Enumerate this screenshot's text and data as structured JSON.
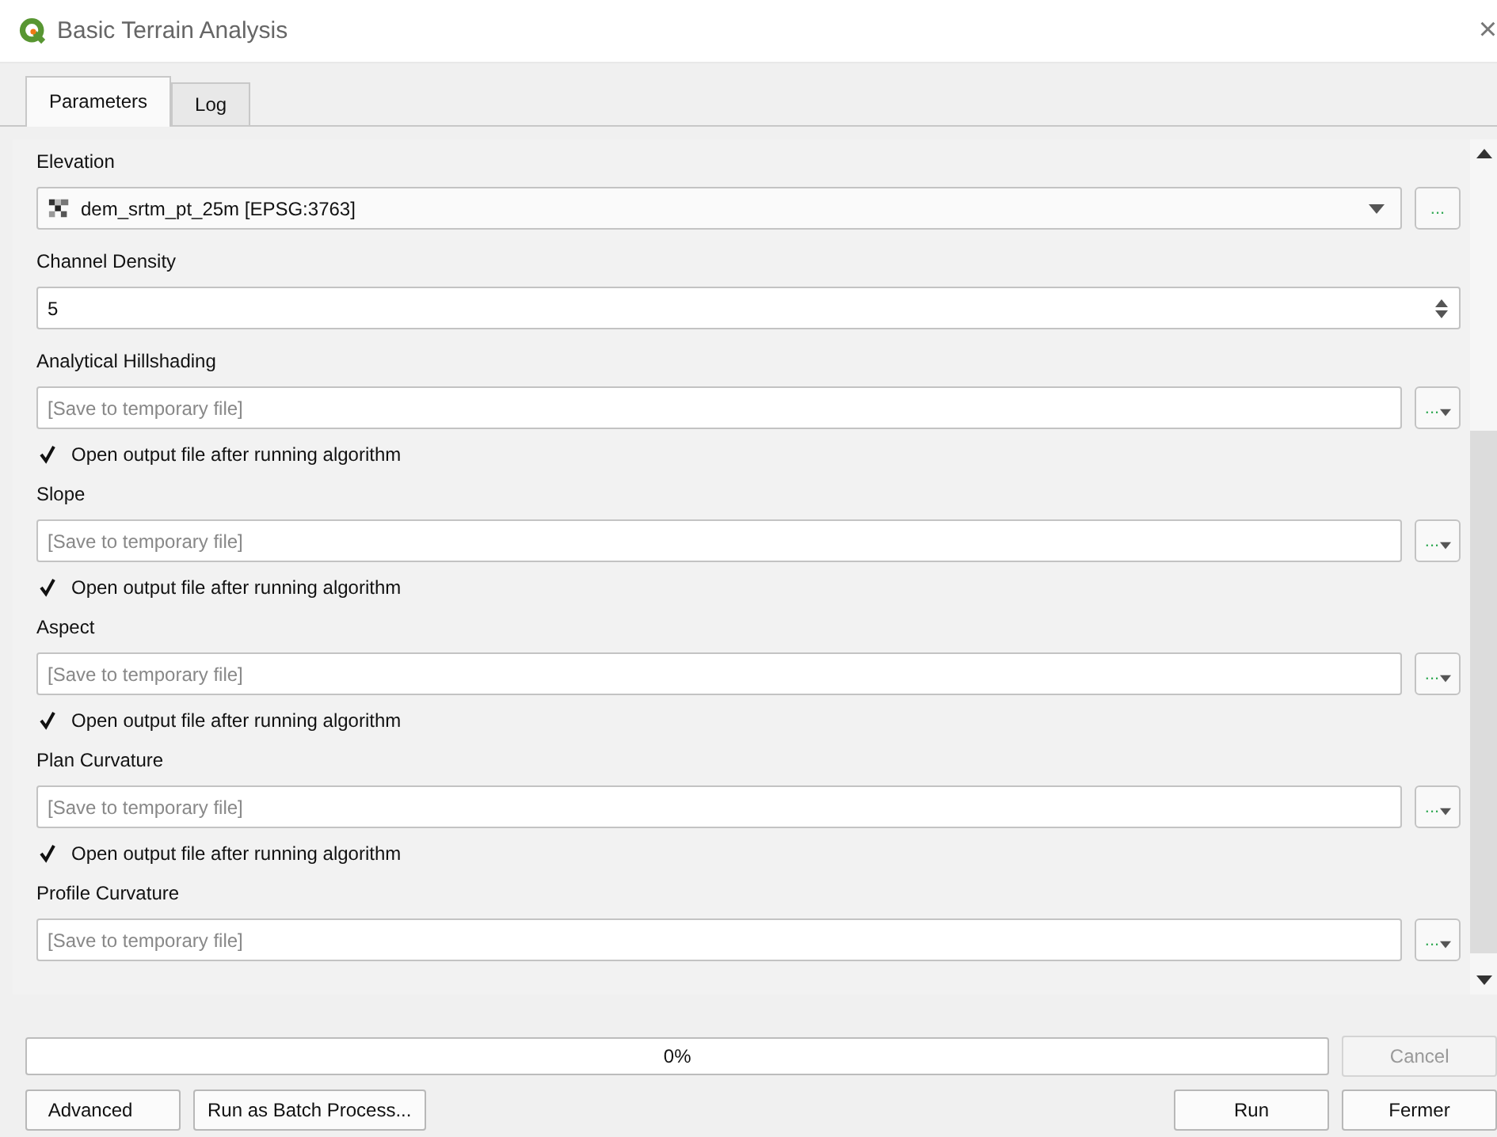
{
  "window": {
    "title": "Basic Terrain Analysis",
    "close": "×"
  },
  "tabs": [
    {
      "label": "Parameters",
      "selected": true
    },
    {
      "label": "Log",
      "selected": false
    }
  ],
  "params": [
    {
      "kind": "layer",
      "label": "Elevation",
      "value": "dem_srtm_pt_25m [EPSG:3763]",
      "button": "..."
    },
    {
      "kind": "number",
      "label": "Channel Density",
      "value": "5"
    },
    {
      "kind": "output",
      "label": "Analytical Hillshading",
      "placeholder": "[Save to temporary file]",
      "button": "...",
      "open_output": {
        "label": "Open output file after running algorithm",
        "checked": true
      }
    },
    {
      "kind": "output",
      "label": "Slope",
      "placeholder": "[Save to temporary file]",
      "button": "...",
      "open_output": {
        "label": "Open output file after running algorithm",
        "checked": true
      }
    },
    {
      "kind": "output",
      "label": "Aspect",
      "placeholder": "[Save to temporary file]",
      "button": "...",
      "open_output": {
        "label": "Open output file after running algorithm",
        "checked": true
      }
    },
    {
      "kind": "output",
      "label": "Plan Curvature",
      "placeholder": "[Save to temporary file]",
      "button": "...",
      "open_output": {
        "label": "Open output file after running algorithm",
        "checked": true
      }
    },
    {
      "kind": "output",
      "label": "Profile Curvature",
      "placeholder": "[Save to temporary file]",
      "button": "..."
    }
  ],
  "progress": {
    "level": 0,
    "text": "0%"
  },
  "buttons": [
    {
      "label": "Advanced",
      "kind": "dropdown",
      "disabled": false
    },
    {
      "label": "Run as Batch Process...",
      "kind": "plain",
      "disabled": false
    },
    {
      "label": "Run",
      "kind": "plain",
      "disabled": false
    },
    {
      "label": "Fermer",
      "kind": "plain",
      "disabled": false
    }
  ],
  "cancel": {
    "label": "Cancel",
    "disabled": true
  }
}
